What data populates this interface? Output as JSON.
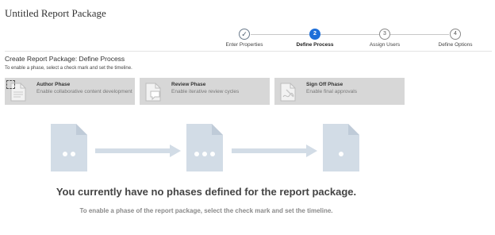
{
  "page": {
    "title": "Untitled Report Package"
  },
  "train": {
    "steps": [
      {
        "number": "✓",
        "label": "Enter Properties",
        "state": "done"
      },
      {
        "number": "2",
        "label": "Define Process",
        "state": "active"
      },
      {
        "number": "3",
        "label": "Assign Users",
        "state": "pending"
      },
      {
        "number": "4",
        "label": "Define Options",
        "state": "pending"
      }
    ]
  },
  "section": {
    "title": "Create Report Package: Define Process",
    "instructions": "To enable a phase, select a check mark and set the timeline."
  },
  "phases": [
    {
      "title": "Author Phase",
      "description": "Enable collaborative content development",
      "icon": "document-edit-icon"
    },
    {
      "title": "Review Phase",
      "description": "Enable iterative review cycles",
      "icon": "document-comment-icon"
    },
    {
      "title": "Sign Off Phase",
      "description": "Enable final approvals",
      "icon": "document-signature-icon"
    }
  ],
  "empty_state": {
    "title": "You currently have no phases defined for the report package.",
    "subtitle": "To enable a phase of the report package, select the check mark and set the timeline."
  },
  "colors": {
    "accent": "#1e6fd9",
    "card_bg": "#d7d7d7",
    "diagram": "#d2dce6"
  }
}
